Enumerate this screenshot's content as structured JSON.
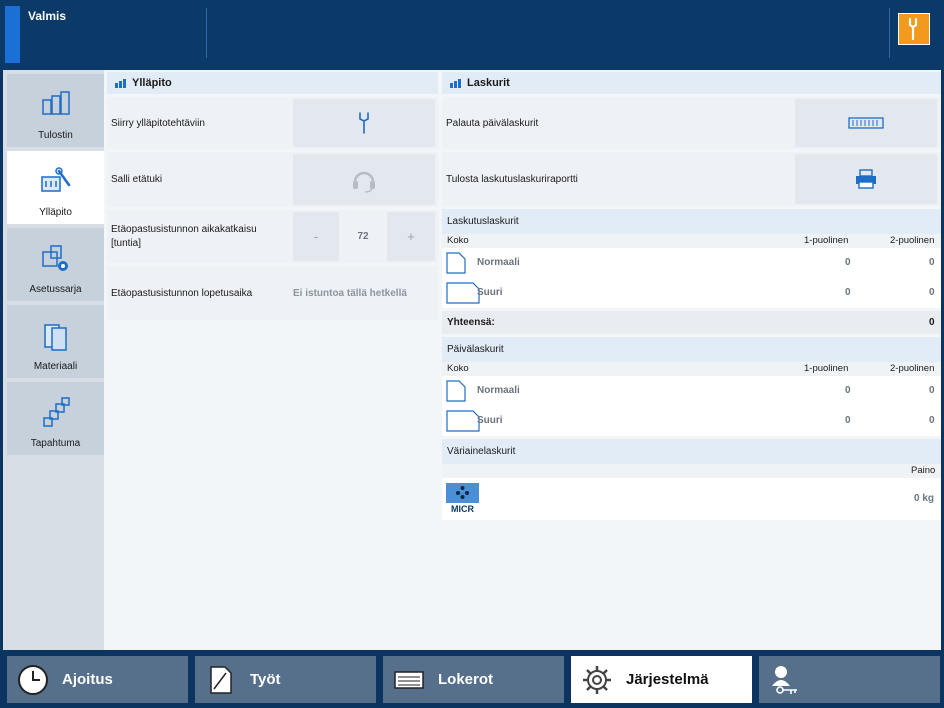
{
  "status": {
    "text": "Valmis"
  },
  "nav": {
    "items": [
      {
        "label": "Tulostin"
      },
      {
        "label": "Ylläpito"
      },
      {
        "label": "Asetussarja"
      },
      {
        "label": "Materiaali"
      },
      {
        "label": "Tapahtuma"
      }
    ]
  },
  "yllapito": {
    "title": "Ylläpito",
    "rows": {
      "goto_maintenance": "Siirry ylläpitotehtäviin",
      "allow_remote": "Salli etätuki",
      "timeout_label": "Etäopastusistunnon aikakatkaisu [tuntia]",
      "timeout_value": "72",
      "minus": "-",
      "plus": "+",
      "end_time_label": "Etäopastusistunnon lopetusaika",
      "end_time_value": "Ei istuntoa tällä hetkellä"
    }
  },
  "laskurit": {
    "title": "Laskurit",
    "reset_daily": "Palauta päivälaskurit",
    "print_report": "Tulosta laskutuslaskuriraportti",
    "billing": {
      "title": "Laskutuslaskurit",
      "col_size": "Koko",
      "col_1": "1-puolinen",
      "col_2": "2-puolinen",
      "rows": [
        {
          "name": "Normaali",
          "v1": "0",
          "v2": "0"
        },
        {
          "name": "Suuri",
          "v1": "0",
          "v2": "0"
        }
      ],
      "total_label": "Yhteensä:",
      "total_value": "0"
    },
    "daily": {
      "title": "Päivälaskurit",
      "col_size": "Koko",
      "col_1": "1-puolinen",
      "col_2": "2-puolinen",
      "rows": [
        {
          "name": "Normaali",
          "v1": "0",
          "v2": "0"
        },
        {
          "name": "Suuri",
          "v1": "0",
          "v2": "0"
        }
      ]
    },
    "color": {
      "title": "Väriainelaskurit",
      "col_weight": "Paino",
      "micr_label": "MICR",
      "value": "0 kg"
    }
  },
  "tabs": [
    {
      "label": "Ajoitus"
    },
    {
      "label": "Työt"
    },
    {
      "label": "Lokerot"
    },
    {
      "label": "Järjestelmä"
    },
    {
      "label": ""
    }
  ],
  "colors": {
    "accent": "#1b70d6",
    "warning": "#f29a1e",
    "topbar": "#0c3a68"
  }
}
